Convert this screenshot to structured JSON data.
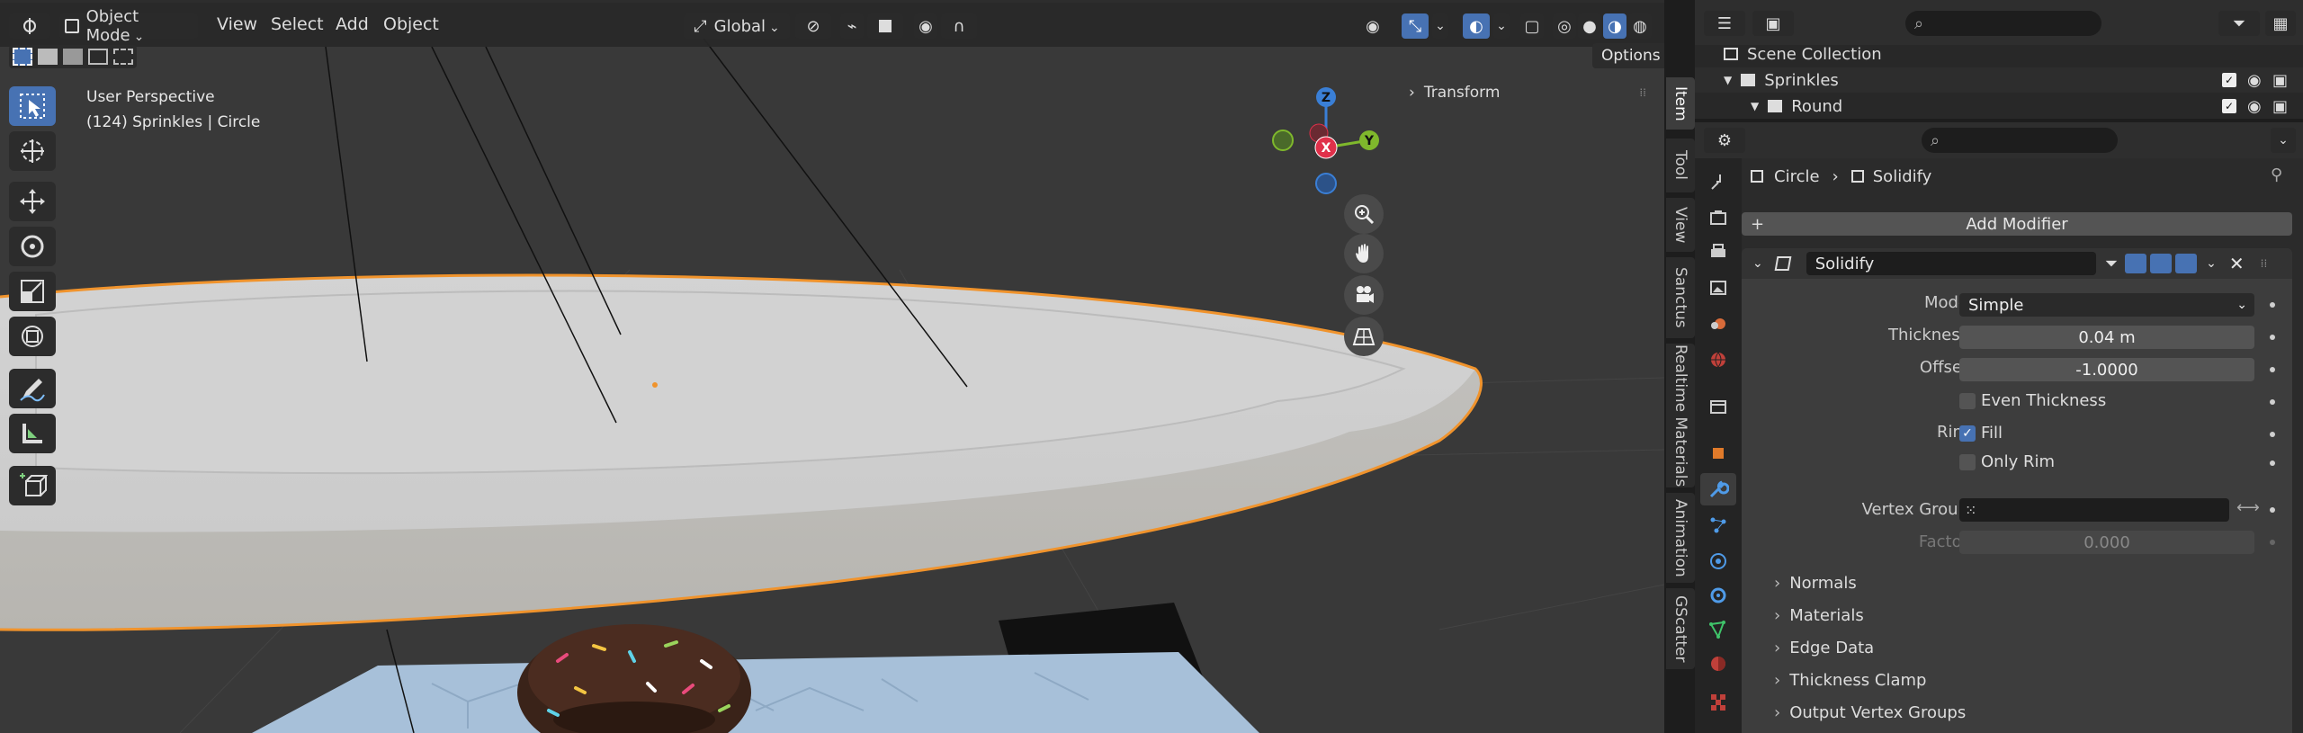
{
  "header": {
    "mode": "Object Mode",
    "menus": [
      "View",
      "Select",
      "Add",
      "Object"
    ],
    "transform_orientation": "Global",
    "options_label": "Options"
  },
  "viewport": {
    "overlay_line1": "User Perspective",
    "overlay_line2": "(124) Sprinkles | Circle",
    "transform_panel": "Transform",
    "gizmo": {
      "x": "X",
      "y": "Y",
      "z": "Z"
    }
  },
  "sidebar_tabs": [
    "Item",
    "Tool",
    "View",
    "Sanctus",
    "Realtime Materials",
    "Animation",
    "GScatter"
  ],
  "outliner": {
    "rows": [
      {
        "label": "Scene Collection"
      },
      {
        "label": "Sprinkles"
      },
      {
        "label": "Round"
      }
    ]
  },
  "properties": {
    "breadcrumb_object": "Circle",
    "breadcrumb_modifier": "Solidify",
    "add_modifier": "Add Modifier",
    "modifier_name": "Solidify",
    "mode_label": "Mode",
    "mode_value": "Simple",
    "thickness_label": "Thickness",
    "thickness_value": "0.04 m",
    "offset_label": "Offset",
    "offset_value": "-1.0000",
    "even_thickness": "Even Thickness",
    "rim_label": "Rim",
    "fill": "Fill",
    "only_rim": "Only Rim",
    "vertex_group_label": "Vertex Group",
    "factor_label": "Factor",
    "factor_value": "0.000",
    "subpanels": [
      "Normals",
      "Materials",
      "Edge Data",
      "Thickness Clamp",
      "Output Vertex Groups"
    ]
  },
  "colors": {
    "accent": "#4772b3",
    "selection_outline": "#f0932c",
    "axis_x": "#e0304a",
    "axis_y": "#7fb82c",
    "axis_z": "#3a7fd6"
  }
}
